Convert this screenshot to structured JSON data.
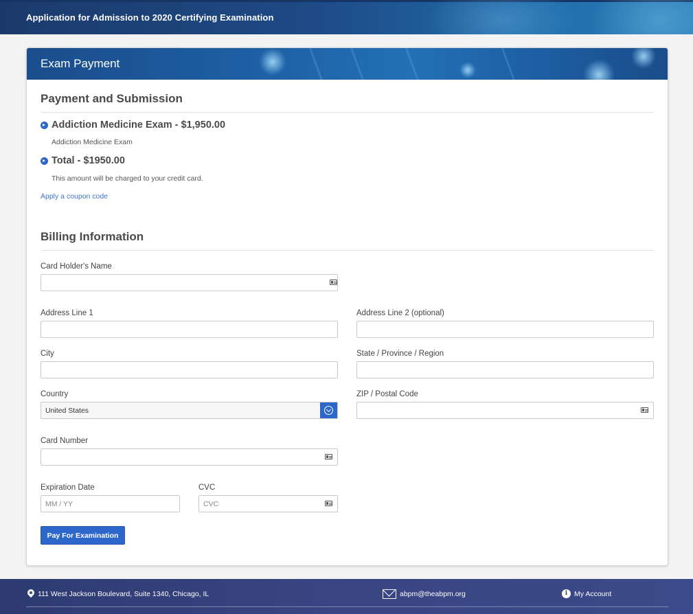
{
  "header": {
    "title": "Application for Admission to 2020 Certifying Examination"
  },
  "card": {
    "title": "Exam Payment"
  },
  "payment": {
    "section_title": "Payment and Submission",
    "items": [
      {
        "title": "Addiction Medicine Exam - $1,950.00",
        "subtitle": "Addiction Medicine Exam"
      },
      {
        "title": "Total - $1950.00",
        "subtitle": "This amount will be charged to your credit card."
      }
    ],
    "coupon_link": "Apply a coupon code"
  },
  "billing": {
    "section_title": "Billing Information",
    "fields": {
      "card_holder": {
        "label": "Card Holder's Name",
        "value": "",
        "placeholder": ""
      },
      "address1": {
        "label": "Address Line 1",
        "value": "",
        "placeholder": ""
      },
      "address2": {
        "label": "Address Line 2 (optional)",
        "value": "",
        "placeholder": ""
      },
      "city": {
        "label": "City",
        "value": "",
        "placeholder": ""
      },
      "state": {
        "label": "State / Province / Region",
        "value": "",
        "placeholder": ""
      },
      "country": {
        "label": "Country",
        "value": "United States"
      },
      "zip": {
        "label": "ZIP / Postal Code",
        "value": "",
        "placeholder": ""
      },
      "card_number": {
        "label": "Card Number",
        "value": "",
        "placeholder": ""
      },
      "expiration": {
        "label": "Expiration Date",
        "value": "",
        "placeholder": "MM / YY"
      },
      "cvc": {
        "label": "CVC",
        "value": "",
        "placeholder": "CVC"
      }
    },
    "submit_label": "Pay For Examination"
  },
  "footer": {
    "address": "111 West Jackson Boulevard, Suite 1340, Chicago, IL",
    "email": "abpm@theabpm.org",
    "account": "My Account"
  },
  "icons": {
    "field_icon": "id-card-icon",
    "select_icon": "chevron-down-circle-icon",
    "bullet_icon": "chevron-right-circle-icon",
    "address_icon": "map-pin-icon",
    "email_icon": "envelope-icon",
    "account_icon": "info-icon"
  },
  "colors": {
    "accent": "#2c67c9",
    "header": "#1e4a86",
    "footer": "#3a4583",
    "link": "#3b74c6"
  }
}
